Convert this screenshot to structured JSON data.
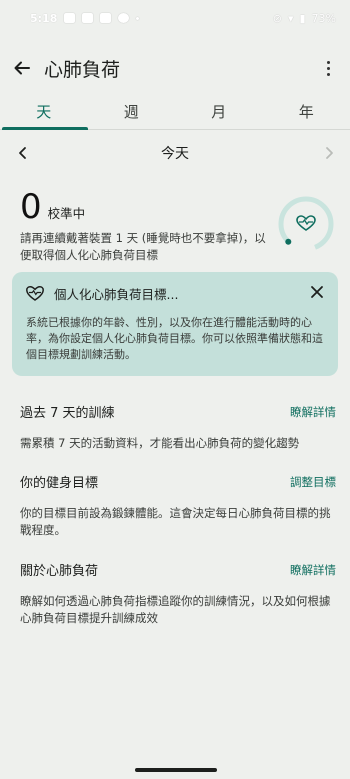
{
  "status_bar": {
    "time": "5:18",
    "battery": "73%"
  },
  "header": {
    "title": "心肺負荷"
  },
  "tabs": [
    {
      "label": "天",
      "active": true
    },
    {
      "label": "週",
      "active": false
    },
    {
      "label": "月",
      "active": false
    },
    {
      "label": "年",
      "active": false
    }
  ],
  "date_nav": {
    "label": "今天"
  },
  "load": {
    "value": "0",
    "status": "校準中",
    "description": "請再連續戴著裝置 1 天 (睡覺時也不要拿掉)，以便取得個人化心肺負荷目標"
  },
  "info_card": {
    "title": "個人化心肺負荷目標...",
    "body": "系統已根據你的年齡、性別，以及你在進行體能活動時的心率，為你設定個人化心肺負荷目標。你可以依照準備狀態和這個目標規劃訓練活動。"
  },
  "sections": [
    {
      "title": "過去 7 天的訓練",
      "link": "瞭解詳情",
      "description": "需累積 7 天的活動資料，才能看出心肺負荷的變化趨勢"
    },
    {
      "title": "你的健身目標",
      "link": "調整目標",
      "description": "你的目標目前設為鍛鍊體能。這會決定每日心肺負荷目標的挑戰程度。"
    },
    {
      "title": "關於心肺負荷",
      "link": "瞭解詳情",
      "description": "瞭解如何透過心肺負荷指標追蹤你的訓練情況，以及如何根據心肺負荷目標提升訓練成效"
    }
  ],
  "colors": {
    "accent": "#0f6e5f",
    "card_bg": "#c4e0da",
    "background": "#eef0ed"
  }
}
